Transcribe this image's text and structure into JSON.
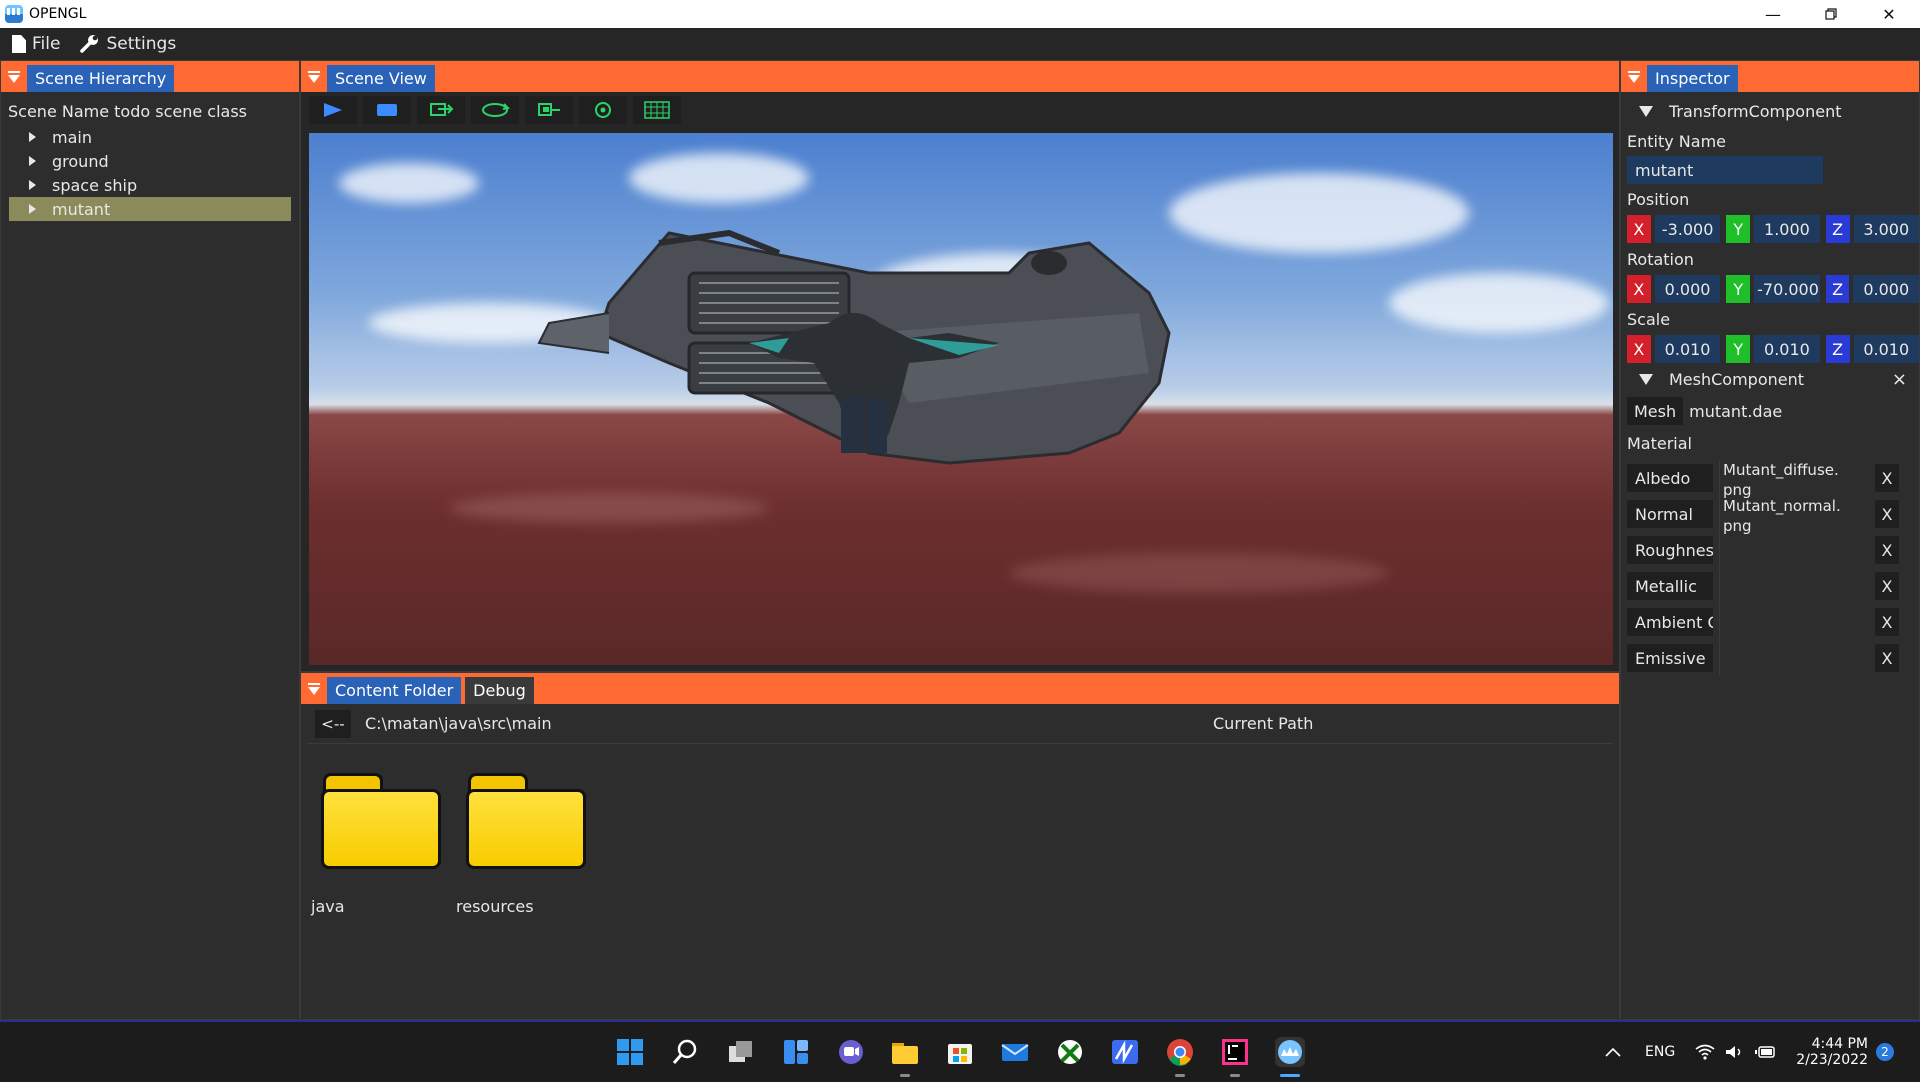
{
  "window": {
    "title": "OPENGL"
  },
  "menu": {
    "file": "File",
    "settings": "Settings"
  },
  "hierarchy": {
    "tab": "Scene Hierarchy",
    "scene_name": "Scene Name todo scene class",
    "items": [
      "main",
      "ground",
      "space ship",
      "mutant"
    ],
    "selected": "mutant"
  },
  "scene_view": {
    "tab": "Scene View",
    "tools": [
      "play-icon",
      "stop-icon",
      "move-tool-icon",
      "rotate-tool-icon",
      "scale-tool-icon",
      "camera-tool-icon",
      "grid-icon"
    ]
  },
  "content": {
    "tabs": [
      "Content Folder",
      "Debug"
    ],
    "back_label": "<--",
    "path": "C:\\matan\\java\\src\\main",
    "path_label": "Current Path",
    "folders": [
      "java",
      "resources"
    ]
  },
  "inspector": {
    "tab": "Inspector",
    "transform": {
      "title": "TransformComponent",
      "entity_name_label": "Entity Name",
      "entity_name": "mutant",
      "position_label": "Position",
      "position": {
        "x": "-3.000",
        "y": "1.000",
        "z": "3.000"
      },
      "rotation_label": "Rotation",
      "rotation": {
        "x": "0.000",
        "y": "-70.000",
        "z": "0.000"
      },
      "scale_label": "Scale",
      "scale": {
        "x": "0.010",
        "y": "0.010",
        "z": "0.010"
      },
      "axis_labels": {
        "x": "X",
        "y": "Y",
        "z": "Z"
      }
    },
    "mesh": {
      "title": "MeshComponent",
      "close": "×",
      "mesh_label": "Mesh",
      "mesh_file": "mutant.dae",
      "material_label": "Material",
      "remove_label": "X",
      "slots": [
        {
          "name": "Albedo",
          "file_line1": "Mutant_diffuse.",
          "file_line2": "png"
        },
        {
          "name": "Normal",
          "file_line1": "Mutant_normal.",
          "file_line2": "png"
        },
        {
          "name": "Roughness",
          "file_line1": "",
          "file_line2": ""
        },
        {
          "name": "Metallic",
          "file_line1": "",
          "file_line2": ""
        },
        {
          "name": "Ambient Occlusion",
          "file_line1": "",
          "file_line2": ""
        },
        {
          "name": "Emissive",
          "file_line1": "",
          "file_line2": ""
        }
      ]
    }
  },
  "taskbar": {
    "lang": "ENG",
    "time": "4:44 PM",
    "date": "2/23/2022",
    "notifications": "2",
    "apps": [
      "start-icon",
      "search-icon",
      "task-view-icon",
      "widgets-icon",
      "chat-icon",
      "file-explorer-icon",
      "store-icon",
      "mail-icon",
      "xbox-icon",
      "visual-studio-icon",
      "chrome-icon",
      "intellij-icon",
      "opengl-app-icon"
    ]
  },
  "colors": {
    "accent": "#ff6a33",
    "tab_active": "#2a62b8",
    "selected_row": "#8a8a5a",
    "field_bg": "#1e3a5e"
  }
}
